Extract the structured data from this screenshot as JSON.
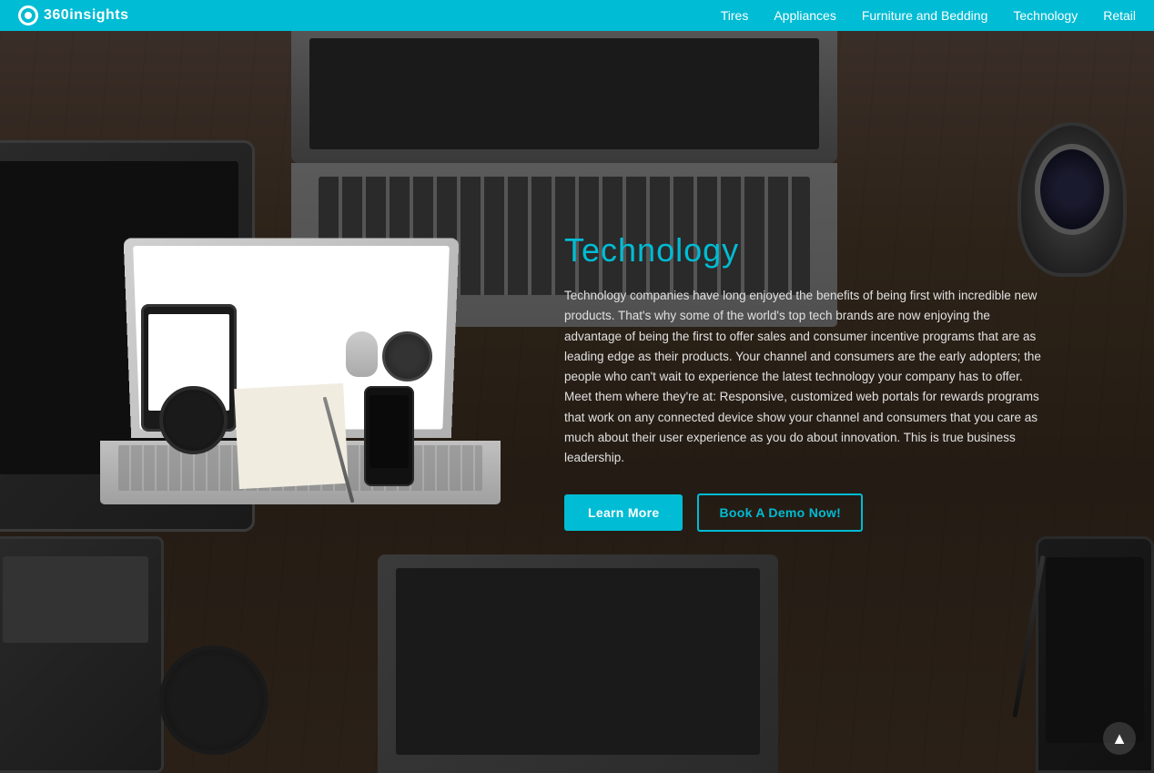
{
  "navbar": {
    "logo_text": "360insights",
    "nav_items": [
      {
        "label": "Tires",
        "id": "tires"
      },
      {
        "label": "Appliances",
        "id": "appliances"
      },
      {
        "label": "Furniture and Bedding",
        "id": "furniture"
      },
      {
        "label": "Technology",
        "id": "technology"
      },
      {
        "label": "Retail",
        "id": "retail"
      }
    ]
  },
  "content": {
    "title": "Technology",
    "body": "Technology companies have long enjoyed the benefits of being first with incredible new products. That's why some of the world's top tech brands are now enjoying the advantage of being the first to offer sales and consumer incentive programs that are as leading edge as their products. Your channel and consumers are the early adopters; the people who can't wait to experience the latest technology your company has to offer. Meet them where they're at: Responsive, customized web portals for rewards programs that work on any connected device show your channel and consumers that you care as much about their user experience as you do about innovation. This is true business leadership.",
    "btn_learn": "Learn More",
    "btn_demo": "Book A Demo Now!"
  },
  "scroll_up": "▲",
  "colors": {
    "accent": "#00bcd4",
    "nav_bg": "#00bcd4",
    "bg": "#2c2420"
  }
}
